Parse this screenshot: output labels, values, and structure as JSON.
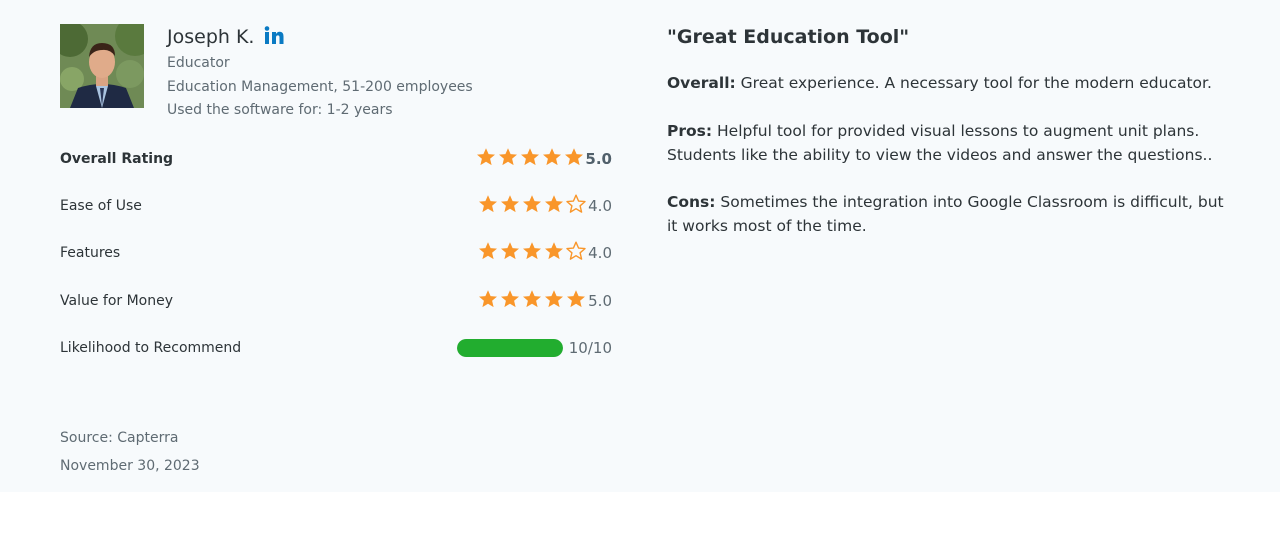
{
  "reviewer": {
    "name": "Joseph K.",
    "role": "Educator",
    "company": "Education Management, 51-200 employees",
    "usage": "Used the software for: 1-2 years",
    "social_icon": "linkedin-icon"
  },
  "ratings": {
    "overall": {
      "label": "Overall Rating",
      "value": "5.0",
      "stars": 5
    },
    "ease_of_use": {
      "label": "Ease of Use",
      "value": "4.0",
      "stars": 4
    },
    "features": {
      "label": "Features",
      "value": "4.0",
      "stars": 4
    },
    "value_for_money": {
      "label": "Value for Money",
      "value": "5.0",
      "stars": 5
    },
    "likelihood": {
      "label": "Likelihood to Recommend",
      "value": "10/10",
      "fraction": 1.0
    }
  },
  "footer": {
    "source": "Source: Capterra",
    "date": "November 30, 2023"
  },
  "review": {
    "title": "\"Great Education Tool\"",
    "overall_label": "Overall:",
    "overall_text": " Great experience. A necessary tool for the modern educator.",
    "pros_label": "Pros:",
    "pros_text": " Helpful tool for provided visual lessons to augment unit plans. Students like the ability to view the videos and answer the questions..",
    "cons_label": "Cons:",
    "cons_text": " Sometimes the integration into Google Classroom is difficult, but it works most of the time."
  },
  "colors": {
    "star": "#f9962a",
    "bar": "#22ad2f",
    "linkedin": "#0a7ac3",
    "card_bg": "#f7fafc"
  }
}
